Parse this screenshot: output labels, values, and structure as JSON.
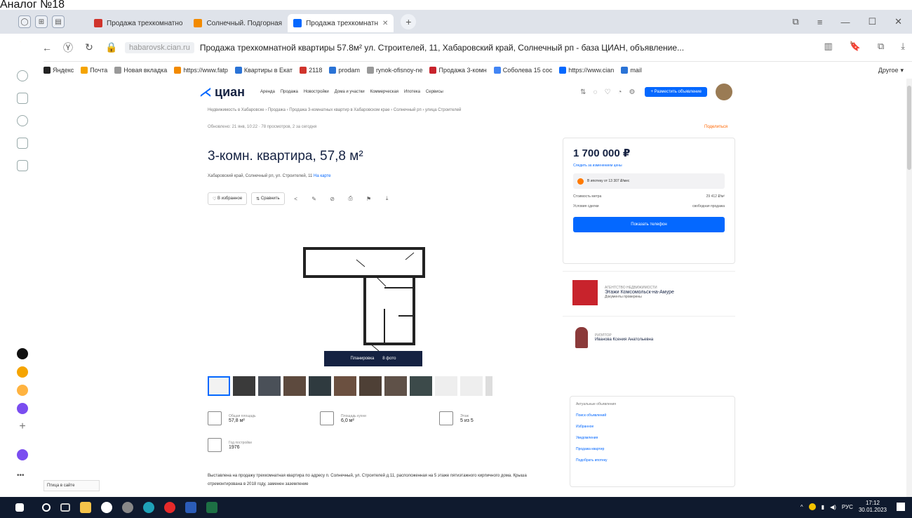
{
  "doc_caption": "Аналог №18",
  "browser": {
    "tabs": [
      {
        "title": "Продажа трехкомнатно",
        "color": "#d0342c",
        "active": false
      },
      {
        "title": "Солнечный. Подгорная",
        "color": "#f28a00",
        "active": false
      },
      {
        "title": "Продажа трехкомнатн",
        "color": "#0468ff",
        "active": true
      }
    ],
    "domain": "habarovsk.cian.ru",
    "page_title": "Продажа трехкомнатной квартиры 57.8м² ул. Строителей, 11, Хабаровский край, Солнечный рп - база ЦИАН, объявление...",
    "bookmarks": [
      {
        "label": "Яндекс",
        "color": "#222"
      },
      {
        "label": "Почта",
        "color": "#f5a400"
      },
      {
        "label": "Новая вкладка",
        "color": "#999"
      },
      {
        "label": "https://www.fatp",
        "color": "#f28a00"
      },
      {
        "label": "Квартиры в Екат",
        "color": "#2a73d6"
      },
      {
        "label": "2118",
        "color": "#d0342c"
      },
      {
        "label": "prodam",
        "color": "#2a73d6"
      },
      {
        "label": "rynok-ofisnoy-ne",
        "color": "#999"
      },
      {
        "label": "Продажа 3-комн",
        "color": "#c8232c"
      },
      {
        "label": "Соболева 15 сос",
        "color": "#4285f4"
      },
      {
        "label": "https://www.cian",
        "color": "#0468ff"
      },
      {
        "label": "mail",
        "color": "#2a73d6"
      },
      {
        "label": "Другое",
        "color": "#999"
      }
    ],
    "window_controls": [
      "⧉",
      "≡",
      "—",
      "☐",
      "✕"
    ]
  },
  "cian": {
    "logo": "циан",
    "menu": [
      "Аренда",
      "Продажа",
      "Новостройки",
      "Дома и участки",
      "Коммерческая",
      "Ипотека",
      "Сервисы"
    ],
    "post_button": "+ Разместить объявление",
    "breadcrumbs": "Недвижимость в Хабаровске › Продажа › Продажа 3-комнатных квартир в Хабаровском крае › Солнечный рп › улица Строителей",
    "meta": "Обновлено: 21 янв, 10:22 · 78 просмотров, 2 за сегодня",
    "share": "Поделиться",
    "title": "3-комн. квартира, 57,8 м²",
    "address": "Хабаровский край, Солнечный рп, ул. Строителей, 11",
    "address_map": "На карте",
    "actions": {
      "favorite": "В избранное",
      "compare": "Сравнить"
    },
    "plan_tabs": {
      "plan": "Планировка",
      "photos": "8 фото"
    },
    "params": {
      "total_area_label": "Общая площадь",
      "total_area": "57,8 м²",
      "kitchen_label": "Площадь кухни",
      "kitchen": "6,0 м²",
      "floor_label": "Этаж",
      "floor": "5 из 5",
      "year_label": "Год постройки",
      "year": "1976"
    },
    "description": "Выставлена на продажу трехкомнатная квартира по адресу п. Солнечный, ул. Строителей д.11, расположенная на 5 этаже пятиэтажного кирпичного дома. Крыша отремонтирована в 2018 году, заменен заземление",
    "price": "1 700 000 ₽",
    "price_sub": "Следить за изменением цены",
    "mortgage": "В ипотеку от 13 307 ₽/мес",
    "price_per_m_label": "Стоимость метра",
    "price_per_m": "29 412 ₽/м²",
    "sale_terms_label": "Условия сделки",
    "sale_terms": "свободная продажа",
    "show_phone": "Показать телефон",
    "agency_label": "АГЕНТСТВО НЕДВИЖИМОСТИ",
    "agency_name": "Этажи Комсомольск-на-Амуре",
    "agency_verified": "Документы проверены",
    "agent_label": "РИЭЛТОР",
    "agent_name": "Иванова Ксения Анатольевна",
    "side_card": {
      "header": "Актуальные объявления",
      "items": [
        "Поиск объявлений",
        "Избранное",
        "Уведомления",
        "Продажа квартир",
        "Подобрать ипотеку"
      ]
    },
    "yandex_button": "Птица в сайте"
  },
  "taskbar": {
    "time": "17:12",
    "date": "30.01.2023",
    "lang": "РУС"
  }
}
